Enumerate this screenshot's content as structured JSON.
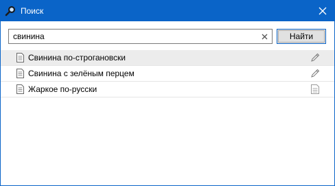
{
  "window": {
    "title": "Поиск",
    "accent_color": "#0a64c8"
  },
  "search": {
    "value": "свинина",
    "placeholder": "",
    "find_label": "Найти"
  },
  "results": [
    {
      "label": "Свинина по-строгановски",
      "icon": "document-icon",
      "action": "edit-pencil-icon",
      "selected": true
    },
    {
      "label": "Свинина с зелёным перцем",
      "icon": "document-icon",
      "action": "edit-pencil-icon",
      "selected": false
    },
    {
      "label": "Жаркое по-русски",
      "icon": "document-icon",
      "action": "document-icon",
      "selected": false
    }
  ]
}
